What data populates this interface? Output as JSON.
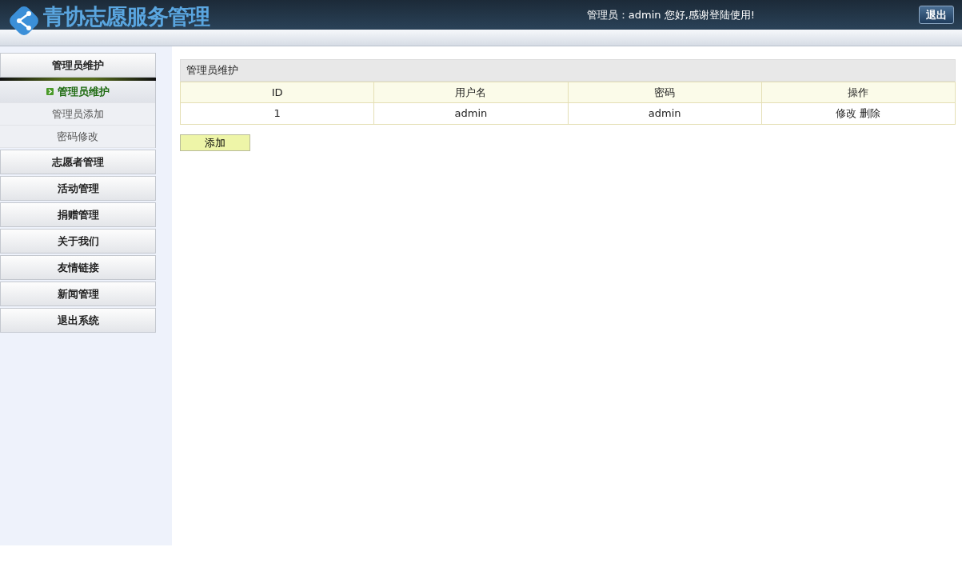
{
  "header": {
    "title": "青协志愿服务管理",
    "greeting": "管理员：admin 您好,感谢登陆使用!",
    "logout": "退出"
  },
  "sidebar": {
    "groups": [
      {
        "label": "管理员维护",
        "expanded": true,
        "children": [
          {
            "label": "管理员维护",
            "selected": true
          },
          {
            "label": "管理员添加",
            "selected": false
          },
          {
            "label": "密码修改",
            "selected": false
          }
        ]
      },
      {
        "label": "志愿者管理",
        "expanded": false
      },
      {
        "label": "活动管理",
        "expanded": false
      },
      {
        "label": "捐赠管理",
        "expanded": false
      },
      {
        "label": "关于我们",
        "expanded": false
      },
      {
        "label": "友情链接",
        "expanded": false
      },
      {
        "label": "新闻管理",
        "expanded": false
      },
      {
        "label": "退出系统",
        "expanded": false
      }
    ]
  },
  "panel": {
    "title": "管理员维护",
    "table": {
      "columns": [
        "ID",
        "用户名",
        "密码",
        "操作"
      ],
      "rows": [
        {
          "cells": [
            "1",
            "admin",
            "admin"
          ],
          "actions": [
            "修改",
            "删除"
          ]
        }
      ]
    },
    "add_button": "添加"
  }
}
